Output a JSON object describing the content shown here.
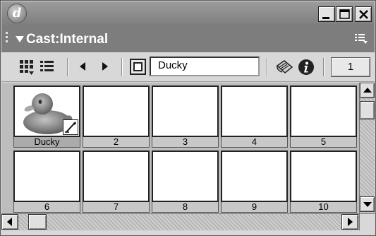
{
  "window": {
    "logo_letter": "d",
    "buttons": [
      "minimize-icon",
      "maximize-icon",
      "close-icon"
    ]
  },
  "panel": {
    "title": "Cast:Internal",
    "options_icon": "panel-options-icon"
  },
  "toolbar": {
    "view_style_icons": [
      "thumbnail-view-icon",
      "list-view-icon"
    ],
    "nav_icons": [
      "previous-cast-member-icon",
      "next-cast-member-icon"
    ],
    "drag_member_icon": "drag-cast-member-icon",
    "member_name": "Ducky",
    "script_icon": "cast-member-script-icon",
    "info_icon": "cast-member-properties-icon",
    "member_number": "1"
  },
  "cast": {
    "members": [
      {
        "label": "Ducky",
        "has_image": true,
        "selected": true
      },
      {
        "label": "2",
        "has_image": false
      },
      {
        "label": "3",
        "has_image": false
      },
      {
        "label": "4",
        "has_image": false
      },
      {
        "label": "5",
        "has_image": false
      },
      {
        "label": "6",
        "has_image": false
      },
      {
        "label": "7",
        "has_image": false
      },
      {
        "label": "8",
        "has_image": false
      },
      {
        "label": "9",
        "has_image": false
      },
      {
        "label": "10",
        "has_image": false
      }
    ]
  },
  "colors": {
    "title_bar": "#7e7e7e",
    "panel_header": "#7d7d7d",
    "cast_background": "#bdbdbd",
    "duck_body": "#8a8a8a"
  }
}
